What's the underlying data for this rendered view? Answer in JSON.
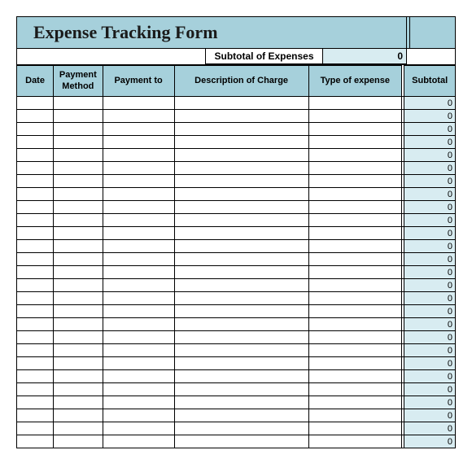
{
  "title": "Expense Tracking Form",
  "subtotal_label": "Subtotal of Expenses",
  "subtotal_value": "0",
  "columns": {
    "date": "Date",
    "method": "Payment Method",
    "payto": "Payment to",
    "desc": "Description of  Charge",
    "type": "Type of expense",
    "subtotal": "Subtotal"
  },
  "rows": [
    {
      "date": "",
      "method": "",
      "payto": "",
      "desc": "",
      "type": "",
      "subtotal": "0"
    },
    {
      "date": "",
      "method": "",
      "payto": "",
      "desc": "",
      "type": "",
      "subtotal": "0"
    },
    {
      "date": "",
      "method": "",
      "payto": "",
      "desc": "",
      "type": "",
      "subtotal": "0"
    },
    {
      "date": "",
      "method": "",
      "payto": "",
      "desc": "",
      "type": "",
      "subtotal": "0"
    },
    {
      "date": "",
      "method": "",
      "payto": "",
      "desc": "",
      "type": "",
      "subtotal": "0"
    },
    {
      "date": "",
      "method": "",
      "payto": "",
      "desc": "",
      "type": "",
      "subtotal": "0"
    },
    {
      "date": "",
      "method": "",
      "payto": "",
      "desc": "",
      "type": "",
      "subtotal": "0"
    },
    {
      "date": "",
      "method": "",
      "payto": "",
      "desc": "",
      "type": "",
      "subtotal": "0"
    },
    {
      "date": "",
      "method": "",
      "payto": "",
      "desc": "",
      "type": "",
      "subtotal": "0"
    },
    {
      "date": "",
      "method": "",
      "payto": "",
      "desc": "",
      "type": "",
      "subtotal": "0"
    },
    {
      "date": "",
      "method": "",
      "payto": "",
      "desc": "",
      "type": "",
      "subtotal": "0"
    },
    {
      "date": "",
      "method": "",
      "payto": "",
      "desc": "",
      "type": "",
      "subtotal": "0"
    },
    {
      "date": "",
      "method": "",
      "payto": "",
      "desc": "",
      "type": "",
      "subtotal": "0"
    },
    {
      "date": "",
      "method": "",
      "payto": "",
      "desc": "",
      "type": "",
      "subtotal": "0"
    },
    {
      "date": "",
      "method": "",
      "payto": "",
      "desc": "",
      "type": "",
      "subtotal": "0"
    },
    {
      "date": "",
      "method": "",
      "payto": "",
      "desc": "",
      "type": "",
      "subtotal": "0"
    },
    {
      "date": "",
      "method": "",
      "payto": "",
      "desc": "",
      "type": "",
      "subtotal": "0"
    },
    {
      "date": "",
      "method": "",
      "payto": "",
      "desc": "",
      "type": "",
      "subtotal": "0"
    },
    {
      "date": "",
      "method": "",
      "payto": "",
      "desc": "",
      "type": "",
      "subtotal": "0"
    },
    {
      "date": "",
      "method": "",
      "payto": "",
      "desc": "",
      "type": "",
      "subtotal": "0"
    },
    {
      "date": "",
      "method": "",
      "payto": "",
      "desc": "",
      "type": "",
      "subtotal": "0"
    },
    {
      "date": "",
      "method": "",
      "payto": "",
      "desc": "",
      "type": "",
      "subtotal": "0"
    },
    {
      "date": "",
      "method": "",
      "payto": "",
      "desc": "",
      "type": "",
      "subtotal": "0"
    },
    {
      "date": "",
      "method": "",
      "payto": "",
      "desc": "",
      "type": "",
      "subtotal": "0"
    },
    {
      "date": "",
      "method": "",
      "payto": "",
      "desc": "",
      "type": "",
      "subtotal": "0"
    },
    {
      "date": "",
      "method": "",
      "payto": "",
      "desc": "",
      "type": "",
      "subtotal": "0"
    },
    {
      "date": "",
      "method": "",
      "payto": "",
      "desc": "",
      "type": "",
      "subtotal": "0"
    }
  ]
}
